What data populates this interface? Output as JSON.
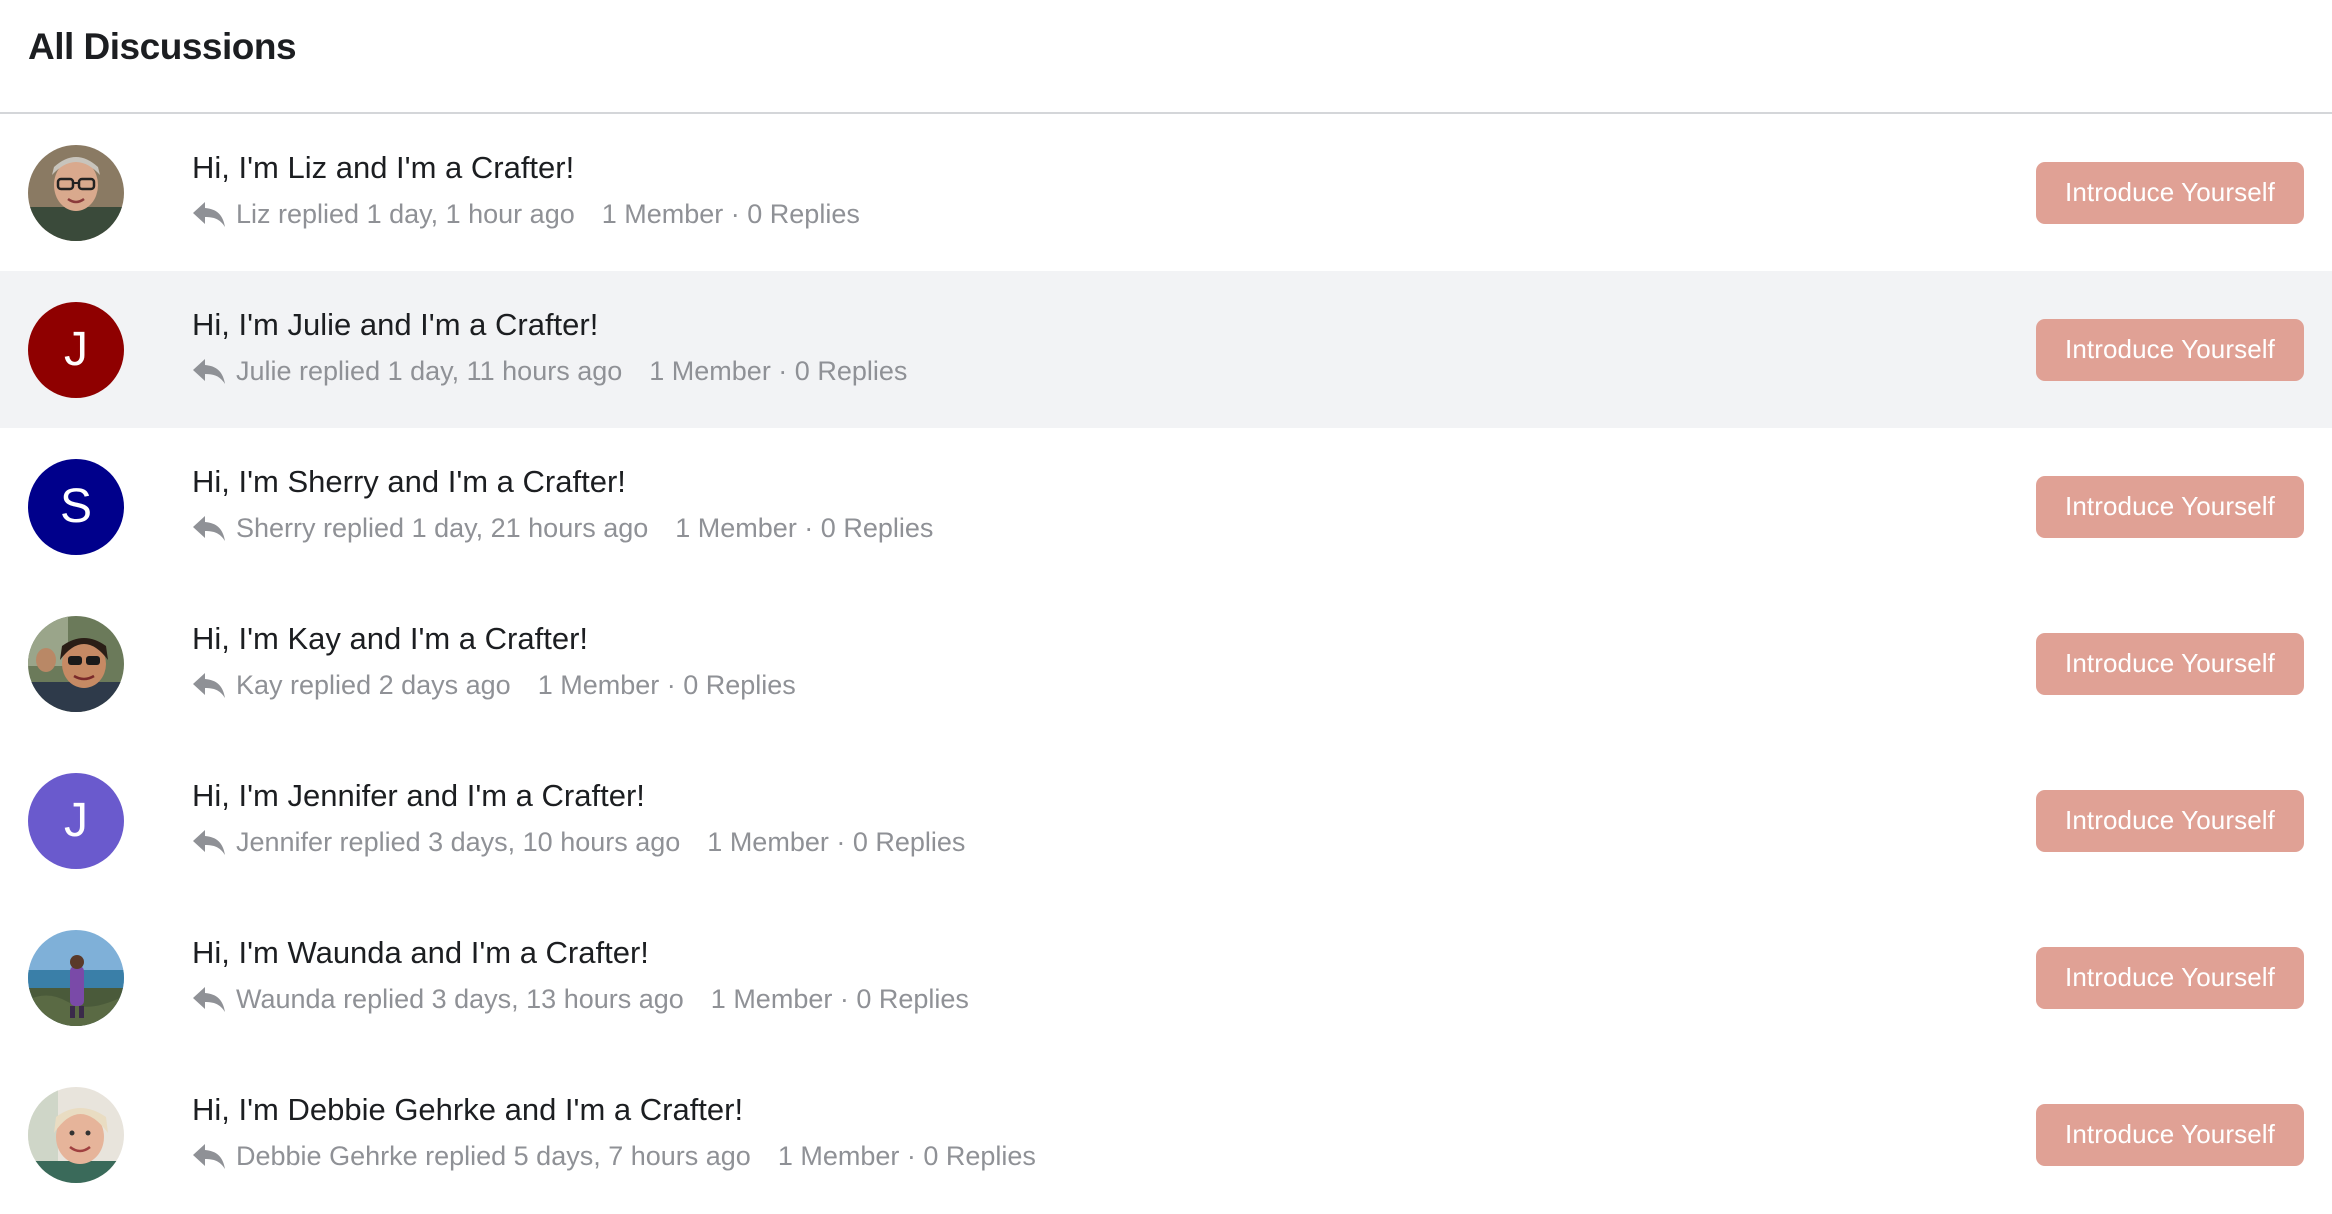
{
  "header": {
    "title": "All Discussions"
  },
  "discussions": [
    {
      "title": "Hi, I'm Liz and I'm a Crafter!",
      "replied": "Liz replied 1 day, 1 hour ago",
      "counts": "1 Member · 0 Replies",
      "button_label": "Introduce Yourself",
      "avatar": {
        "type": "photo",
        "icon": "person-photo-icon"
      }
    },
    {
      "title": "Hi, I'm Julie and I'm a Crafter!",
      "replied": "Julie replied 1 day, 11 hours ago",
      "counts": "1 Member · 0 Replies",
      "button_label": "Introduce Yourself",
      "avatar": {
        "type": "initial",
        "initial": "J",
        "color": "#8f0000"
      }
    },
    {
      "title": "Hi, I'm Sherry and I'm a Crafter!",
      "replied": "Sherry replied 1 day, 21 hours ago",
      "counts": "1 Member · 0 Replies",
      "button_label": "Introduce Yourself",
      "avatar": {
        "type": "initial",
        "initial": "S",
        "color": "#00008b"
      }
    },
    {
      "title": "Hi, I'm Kay and I'm a Crafter!",
      "replied": "Kay replied 2 days ago",
      "counts": "1 Member · 0 Replies",
      "button_label": "Introduce Yourself",
      "avatar": {
        "type": "photo",
        "icon": "person-photo-icon"
      }
    },
    {
      "title": "Hi, I'm Jennifer and I'm a Crafter!",
      "replied": "Jennifer replied 3 days, 10 hours ago",
      "counts": "1 Member · 0 Replies",
      "button_label": "Introduce Yourself",
      "avatar": {
        "type": "initial",
        "initial": "J",
        "color": "#6a5acd"
      }
    },
    {
      "title": "Hi, I'm Waunda and I'm a Crafter!",
      "replied": "Waunda replied 3 days, 13 hours ago",
      "counts": "1 Member · 0 Replies",
      "button_label": "Introduce Yourself",
      "avatar": {
        "type": "photo",
        "icon": "person-photo-icon"
      }
    },
    {
      "title": "Hi, I'm Debbie Gehrke and I'm a Crafter!",
      "replied": "Debbie Gehrke replied 5 days, 7 hours ago",
      "counts": "1 Member · 0 Replies",
      "button_label": "Introduce Yourself",
      "avatar": {
        "type": "photo",
        "icon": "person-photo-icon"
      }
    }
  ],
  "colors": {
    "button_bg": "#e0a195",
    "highlight_row_bg": "#f2f3f5",
    "meta_text": "#8f9196"
  }
}
